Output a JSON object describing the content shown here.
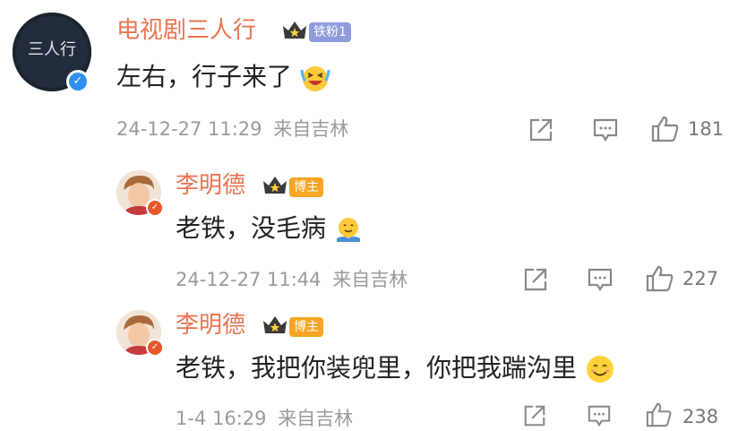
{
  "comments": [
    {
      "author": "电视剧三人行",
      "avatar_text": "三人行",
      "badge": "铁粉1",
      "text": "左右，行子来了",
      "emoji": "laughing-crying-emoji",
      "date": "24-12-27 11:29",
      "location": "来自吉林",
      "likes": "181"
    },
    {
      "author": "李明德",
      "badge": "博主",
      "text": "老铁，没毛病",
      "emoji": "hug-emoji",
      "date": "24-12-27 11:44",
      "location": "来自吉林",
      "likes": "227"
    },
    {
      "author": "李明德",
      "badge": "博主",
      "text": "老铁，我把你装兜里，你把我踹沟里",
      "emoji": "smile-emoji",
      "date": "1-4 16:29",
      "location": "来自吉林",
      "likes": "238"
    }
  ],
  "colors": {
    "name": "#eb7350",
    "fan_badge": "#8e9bdc",
    "host_badge": "#f5a623",
    "verify_blue": "#2e8ff0",
    "verify_red": "#e8572a",
    "meta_gray": "#9a9a9a"
  },
  "icons": [
    "crown-icon",
    "share-icon",
    "comment-icon",
    "like-icon",
    "verified-icon"
  ]
}
